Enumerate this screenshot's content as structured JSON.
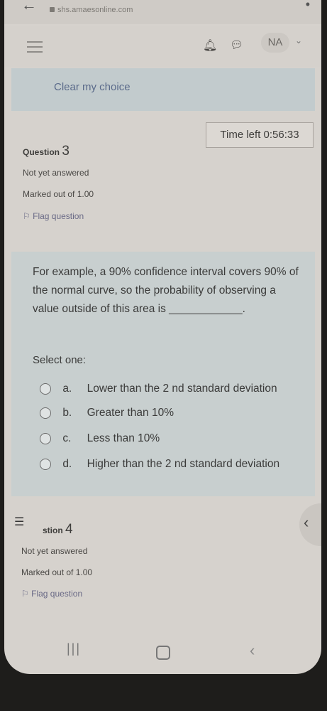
{
  "browser": {
    "url": "shs.amaesonline.com"
  },
  "navbar": {
    "avatar_initials": "NA"
  },
  "prev_question": {
    "clear_choice": "Clear my choice"
  },
  "timer": {
    "label": "Time left 0:56:33"
  },
  "question3": {
    "title_prefix": "Question",
    "number": "3",
    "status": "Not yet answered",
    "marks": "Marked out of 1.00",
    "flag": "Flag question",
    "text": "For example, a 90% confidence interval covers 90% of the normal curve, so the probability of observing a value outside of this area is ____________.",
    "select_label": "Select one:",
    "options": [
      {
        "letter": "a.",
        "text": "Lower than the 2 nd standard deviation"
      },
      {
        "letter": "b.",
        "text": "Greater than 10%"
      },
      {
        "letter": "c.",
        "text": "Less than 10%"
      },
      {
        "letter": "d.",
        "text": "Higher than the 2 nd standard deviation"
      }
    ]
  },
  "question4": {
    "title_prefix": "stion",
    "number": "4",
    "status": "Not yet answered",
    "marks": "Marked out of 1.00",
    "flag": "Flag question"
  }
}
